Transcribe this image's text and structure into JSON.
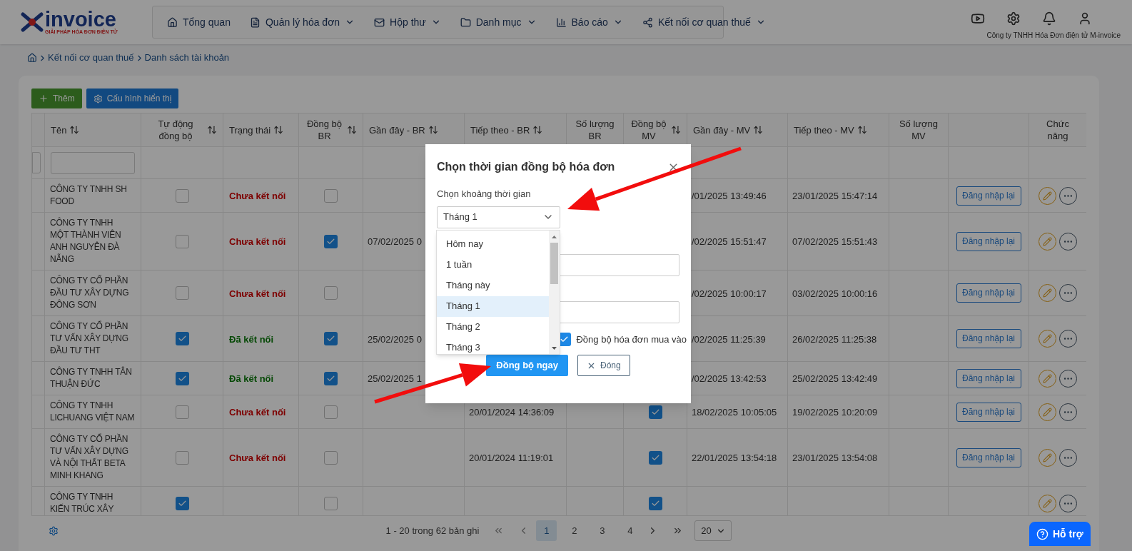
{
  "logo": {
    "name": "invoice",
    "tagline": "GIẢI PHÁP HÓA ĐƠN ĐIỆN TỬ"
  },
  "nav": [
    {
      "label": "Tổng quan",
      "dropdown": false
    },
    {
      "label": "Quản lý hóa đơn",
      "dropdown": true
    },
    {
      "label": "Hộp thư",
      "dropdown": true
    },
    {
      "label": "Danh mục",
      "dropdown": true
    },
    {
      "label": "Báo cáo",
      "dropdown": true
    },
    {
      "label": "Kết nối cơ quan thuế",
      "dropdown": true
    }
  ],
  "company": "Công ty TNHH Hóa Đơn điện tử M-invoice",
  "breadcrumb": [
    "Kết nối cơ quan thuế",
    "Danh sách tài khoản"
  ],
  "toolbar": [
    {
      "label": "Thêm",
      "kind": "add"
    },
    {
      "label": "Cấu hình hiển thị",
      "kind": "config"
    }
  ],
  "table": {
    "columns": [
      {
        "label": "Tên",
        "sortable": true,
        "kind": "name"
      },
      {
        "label": "Tự động đồng bộ",
        "sortable": true,
        "kind": "check"
      },
      {
        "label": "Trạng thái",
        "sortable": true,
        "kind": "status"
      },
      {
        "label": "Đồng bộ BR",
        "sortable": true,
        "kind": "check"
      },
      {
        "label": "Gần đây - BR",
        "sortable": true,
        "kind": "text"
      },
      {
        "label": "Tiếp theo - BR",
        "sortable": true,
        "kind": "text"
      },
      {
        "label": "Số lượng BR",
        "sortable": false,
        "kind": "text"
      },
      {
        "label": "Đồng bộ MV",
        "sortable": true,
        "kind": "check"
      },
      {
        "label": "Gần đây - MV",
        "sortable": true,
        "kind": "text"
      },
      {
        "label": "Tiếp theo - MV",
        "sortable": true,
        "kind": "text"
      },
      {
        "label": "Số lượng MV",
        "sortable": false,
        "kind": "text"
      },
      {
        "kind": "relogin"
      },
      {
        "label": "Chức năng",
        "sortable": false,
        "kind": "functions"
      }
    ],
    "rows": [
      {
        "name": "CÔNG TY TNHH SH\nFOOD",
        "auto_sync": false,
        "status": {
          "label": "Chưa kết nối",
          "connected": false
        },
        "sync_br": false,
        "mv_recent": "/01/2025 13:49:46",
        "mv_next": "23/01/2025 15:47:14",
        "relogin": "Đăng nhập lại"
      },
      {
        "name": "CÔNG TY TNHH\nMỘT THÀNH VIÊN\nANH NGUYÊN ĐÀ\nNẴNG",
        "auto_sync": false,
        "status": {
          "label": "Chưa kết nối",
          "connected": false
        },
        "sync_br": true,
        "br_recent": "07/02/2025 0",
        "mv_recent": "/02/2025 15:51:47",
        "mv_next": "07/02/2025 15:51:43",
        "relogin": "Đăng nhập lại"
      },
      {
        "name": "CÔNG TY CỔ PHẦN\nĐẦU TƯ XÂY DỰNG\nĐÔNG SƠN",
        "auto_sync": false,
        "status": {
          "label": "Chưa kết nối",
          "connected": false
        },
        "sync_br": false,
        "mv_recent": "/02/2025 10:00:17",
        "mv_next": "03/02/2025 10:00:16",
        "relogin": "Đăng nhập lại"
      },
      {
        "name": "CÔNG TY CỔ PHẦN\nTƯ VẤN XÂY DỰNG\nĐẦU TƯ THT",
        "auto_sync": true,
        "status": {
          "label": "Đã kết nối",
          "connected": true
        },
        "sync_br": true,
        "br_recent": "25/02/2025 0",
        "mv_recent": "/02/2025 11:25:39",
        "mv_next": "26/02/2025 11:25:38",
        "relogin": "Đăng nhập lại"
      },
      {
        "name": "CÔNG TY TNHH TÂN\nTHUẬN ĐỨC",
        "auto_sync": true,
        "status": {
          "label": "Đã kết nối",
          "connected": true
        },
        "sync_br": true,
        "br_recent": "25/02/2025 1",
        "mv_recent": "/02/2025 13:42:53",
        "mv_next": "25/02/2025 13:42:49",
        "relogin": "Đăng nhập lại"
      },
      {
        "name": "CÔNG TY TNHH\nLICHUANG VIỆT NAM",
        "auto_sync": false,
        "status": {
          "label": "Chưa kết nối",
          "connected": false
        },
        "sync_br": false,
        "br_next": "20/01/2024 14:36:09",
        "sync_mv": true,
        "mv_recent": "18/02/2025 10:05:05",
        "mv_next": "19/02/2025 10:20:09",
        "relogin": "Đăng nhập lại"
      },
      {
        "name": "CÔNG TY CỔ PHẦN\nTƯ VẤN XÂY DỰNG\nVÀ NỘI THẤT BETA\nMINH KHANG",
        "auto_sync": false,
        "status": {
          "label": "Chưa kết nối",
          "connected": false
        },
        "sync_br": false,
        "br_next": "20/01/2024 11:19:01",
        "sync_mv": true,
        "mv_recent": "22/01/2025 13:54:18",
        "mv_next": "23/01/2025 13:54:08",
        "relogin": "Đăng nhập lại"
      },
      {
        "name": "CÔNG TY TNHH\nKIẾN TRÚC XÂY",
        "auto_sync": true,
        "sync_br": false,
        "sync_mv": true
      }
    ]
  },
  "pagination": {
    "summary": "1 - 20 trong 62 bản ghi",
    "pages": [
      {
        "label": "1",
        "selected": true
      },
      {
        "label": "2",
        "selected": false
      },
      {
        "label": "3",
        "selected": false
      },
      {
        "label": "4",
        "selected": false
      }
    ],
    "page_size": "20"
  },
  "support": "Hỗ trợ",
  "modal": {
    "title": "Chọn thời gian đồng bộ hóa đơn",
    "range_label": "Chọn khoảng thời gian",
    "range_value": "Tháng 1",
    "options": [
      {
        "label": "Hôm nay",
        "selected": false
      },
      {
        "label": "1 tuần",
        "selected": false
      },
      {
        "label": "Tháng này",
        "selected": false
      },
      {
        "label": "Tháng 1",
        "selected": true
      },
      {
        "label": "Tháng 2",
        "selected": false
      },
      {
        "label": "Tháng 3",
        "selected": false
      }
    ],
    "purchase_sync": {
      "label": "Đồng bộ hóa đơn mua vào",
      "checked": true
    },
    "buttons": [
      {
        "label": "Đồng bộ ngay",
        "kind": "primary"
      },
      {
        "label": "Đóng",
        "kind": "close"
      }
    ]
  }
}
